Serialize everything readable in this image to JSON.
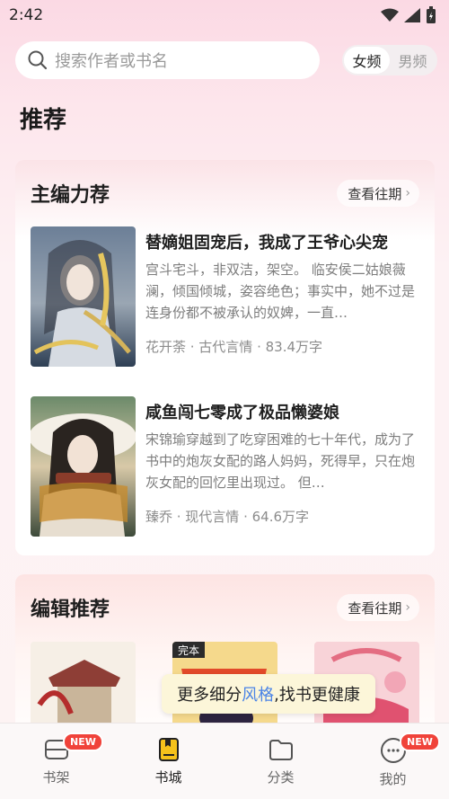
{
  "status": {
    "time": "2:42"
  },
  "search": {
    "placeholder": "搜索作者或书名"
  },
  "gender": {
    "options": [
      "女频",
      "男频"
    ],
    "active": "女频"
  },
  "page_title": "推荐",
  "section_editor_main": {
    "title": "主编力荐",
    "history_label": "查看往期",
    "books": [
      {
        "title": "替嫡姐固宠后，我成了王爷心尖宠",
        "desc": "宫斗宅斗，非双洁，架空。 临安侯二姑娘薇澜，倾国倾城，姿容绝色；事实中，她不过是连身份都不被承认的奴婢，一直…",
        "meta": "花开荼 · 古代言情 · 83.4万字",
        "cover_colors": [
          "#4f6b84",
          "#c9c2b8"
        ]
      },
      {
        "title": "咸鱼闯七零成了极品懒婆娘",
        "desc": "宋锦瑜穿越到了吃穿困难的七十年代，成为了书中的炮灰女配的路人妈妈，死得早，只在炮灰女配的回忆里出现过。 但…",
        "meta": "臻乔 · 现代言情 · 64.6万字",
        "cover_colors": [
          "#3b5a3f",
          "#e9dcc6"
        ]
      }
    ]
  },
  "section_editor_pick": {
    "title": "编辑推荐",
    "history_label": "查看往期",
    "mini_badge": "完本"
  },
  "tooltip": {
    "prefix": "更多细分",
    "highlight": "风格",
    "suffix": ",找书更健康"
  },
  "tabs": [
    {
      "label": "书架",
      "badge": "NEW"
    },
    {
      "label": "书城",
      "badge": ""
    },
    {
      "label": "分类",
      "badge": ""
    },
    {
      "label": "我的",
      "badge": "NEW"
    }
  ],
  "colors": {
    "accent": "#4b84e6",
    "badge": "#f0433a"
  }
}
